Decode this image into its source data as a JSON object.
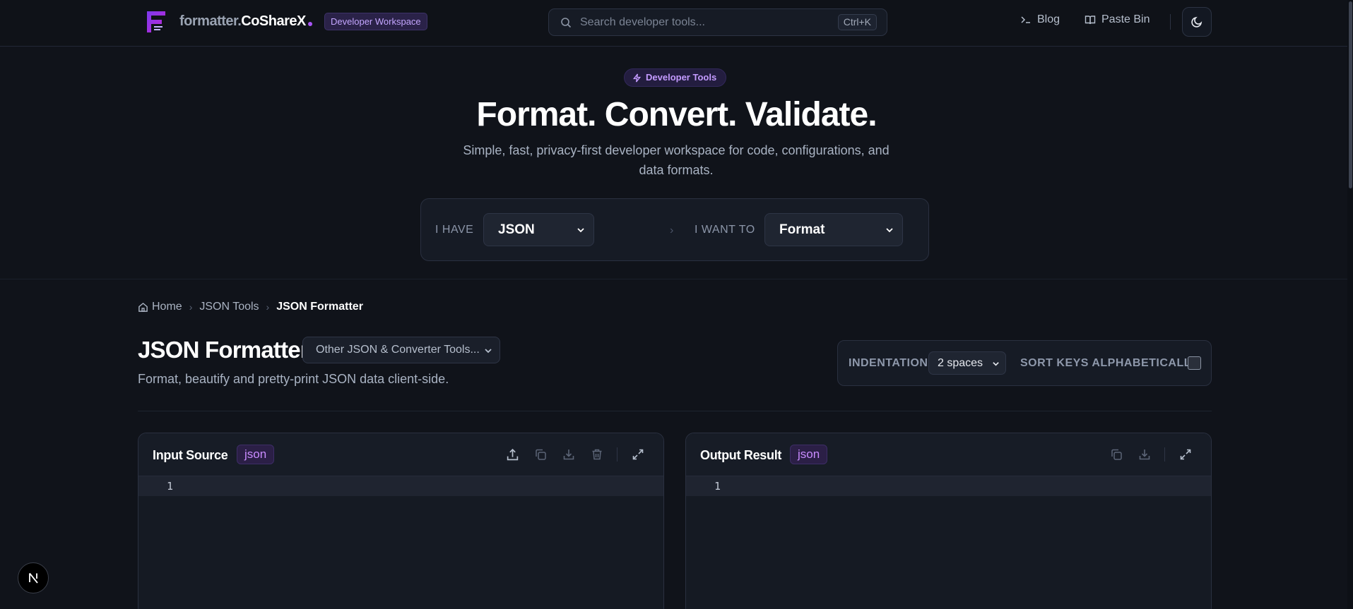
{
  "header": {
    "brand_prefix": "formatter.",
    "brand_name": "CoShareX",
    "workspace_badge": "Developer Workspace",
    "search_placeholder": "Search developer tools...",
    "search_shortcut": "Ctrl+K",
    "nav": [
      {
        "label": "Blog",
        "icon": "terminal-icon"
      },
      {
        "label": "Paste Bin",
        "icon": "book-icon"
      }
    ],
    "theme_toggle_icon": "moon-icon"
  },
  "hero": {
    "pill": "Developer Tools",
    "title": "Format. Convert. Validate.",
    "subtitle": "Simple, fast, privacy-first developer workspace for code, configurations, and data formats.",
    "have_label": "I HAVE",
    "have_value": "JSON",
    "want_label": "I WANT TO",
    "want_value": "Format"
  },
  "breadcrumb": {
    "items": [
      "Home",
      "JSON Tools",
      "JSON Formatter"
    ]
  },
  "page": {
    "title": "JSON Formatter",
    "tools_dropdown": "Other JSON & Converter Tools...",
    "description": "Format, beautify and pretty-print JSON data client-side."
  },
  "options": {
    "indentation_label": "INDENTATION",
    "indentation_value": "2 spaces",
    "sort_label": "SORT KEYS ALPHABETICALLY",
    "sort_checked": false
  },
  "input_panel": {
    "title": "Input Source",
    "lang": "json",
    "line_number": "1",
    "tools": [
      "upload-icon",
      "copy-icon",
      "download-icon",
      "trash-icon",
      "expand-icon"
    ]
  },
  "output_panel": {
    "title": "Output Result",
    "lang": "json",
    "line_number": "1",
    "tools": [
      "copy-icon",
      "download-icon",
      "expand-icon"
    ]
  },
  "colors": {
    "accent": "#a855f7",
    "background": "#10131a",
    "panel": "#161b25"
  }
}
